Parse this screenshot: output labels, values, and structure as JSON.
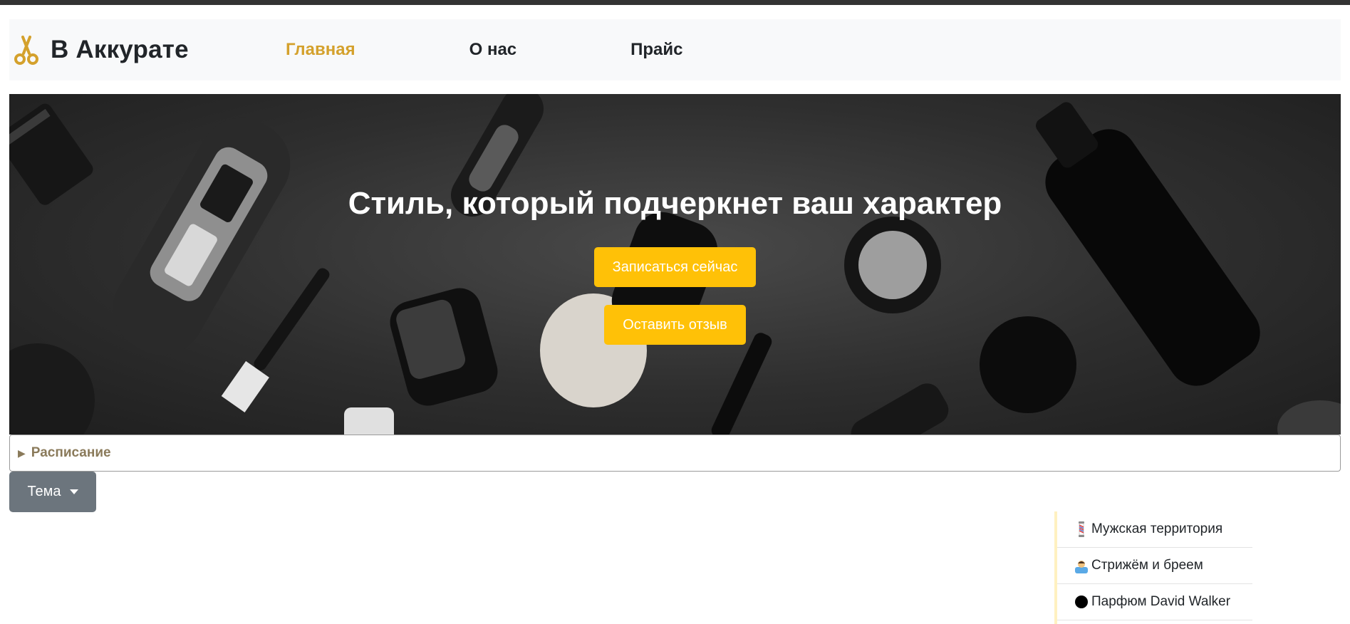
{
  "brand": {
    "name": "В Аккурате",
    "icon": "scissors-icon",
    "accent_color": "#d4a12c"
  },
  "nav": {
    "links": [
      {
        "label": "Главная",
        "active": true
      },
      {
        "label": "О нас",
        "active": false
      },
      {
        "label": "Прайс",
        "active": false
      }
    ]
  },
  "hero": {
    "title": "Стиль, который подчеркнет ваш характер",
    "primary_button": "Записаться сейчас",
    "secondary_button": "Оставить отзыв",
    "button_color": "#ffc107"
  },
  "schedule": {
    "marker": "▶",
    "label": "Расписание"
  },
  "theme_dropdown": {
    "label": "Тема",
    "button_color": "#6c757d"
  },
  "side_list": {
    "items": [
      {
        "icon": "barber-pole-icon",
        "label": "Мужская территория"
      },
      {
        "icon": "haircut-person-icon",
        "label": "Стрижём и бреем"
      },
      {
        "icon": "black-circle-icon",
        "label": "Парфюм David Walker"
      }
    ]
  }
}
